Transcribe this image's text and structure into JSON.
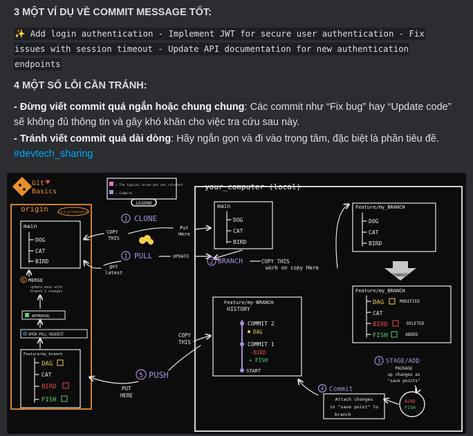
{
  "message": {
    "heading_3": "3 MỘT VÍ DỤ VỀ COMMIT MESSAGE TỐT:",
    "code_line_1": "✨ Add login authentication - Implement JWT for secure user authentication - Fix",
    "code_line_2": "issues with session timeout - Update API documentation for new authentication",
    "code_line_3": "endpoints",
    "heading_4": "4 MỘT SỐ LỖI CẦN TRÁNH:",
    "tip1_dash": "- ",
    "tip1_bold": "Đừng viết commit quá ngắn hoặc chung chung",
    "tip1_rest": ": Các commit như “Fix bug” hay “Update code” sẽ không đủ thông tin và gây khó khăn cho việc tra cứu sau này.",
    "tip2_dash": "- ",
    "tip2_bold": "Tránh viết commit quá dài dòng",
    "tip2_rest": ": Hãy ngắn gọn và đi vào trọng tâm, đặc biệt là phần tiêu đề.",
    "hashtag": "#devtech_sharing"
  },
  "diagram": {
    "logo_line1": "Git",
    "logo_line2": "Basics",
    "legend_item1": "= The typical arrow but not relevant",
    "legend_item2": "= Commits",
    "legend_title": "LEGEND",
    "origin_title": "origin",
    "origin_note": "a.k.a github/gitlab",
    "computer_title": "your_computer (local)",
    "main_label": "main",
    "files_dog": "DOG",
    "files_cat": "CAT",
    "files_bird": "BIRD",
    "files_fish": "FISH",
    "step_clone": "CLONE",
    "clone_copy": "COPY",
    "clone_this": "THIS",
    "put_here_1": "Put",
    "put_here_2": "Here",
    "step_pull": "PULL",
    "pull_update": "UPDATE",
    "pull_get": "get",
    "pull_latest": "latest",
    "step_branch": "BRANCH",
    "branch_copy": "COPY THIS",
    "branch_work": "work on copy Here",
    "feature_branch": "Feature/my_BRANCH",
    "changes": "CHANGES",
    "modified": "MODIFIED",
    "deleted": "DELETED",
    "added": "ADDED",
    "merge_title": "MERGE",
    "merge_desc_1": "update main with",
    "merge_desc_2": "branch's changes",
    "approval": "APPROVAL",
    "open_pr": "OPEN PULL REQUEST",
    "origin_feature": "Feature/my_branch",
    "history_title_1": "Feature/my-BRANCH",
    "history_title_2": "HISTORY",
    "commit_2": "COMMIT 2",
    "commit_2_dag": "DAG",
    "commit_1": "COMMIT 1",
    "commit_1_bird": "-BIRD",
    "commit_1_fish": "+ FISH",
    "history_start": "START",
    "copy_this_push_1": "COPY",
    "copy_this_push_2": "THIS",
    "step_push": "PUSH",
    "push_put_1": "PUT",
    "push_put_2": "HERE",
    "step_stage": "STAGE/ADD",
    "stage_desc_1": "PACKAGE",
    "stage_desc_2": "up changes as",
    "stage_desc_3": "\"save points\"",
    "step_commit": "Commit",
    "commit_desc_1": "Attach changes",
    "commit_desc_2": "in \"save point\" to",
    "commit_desc_3": "branch",
    "num_1": "1",
    "num_2": "2",
    "num_3": "3",
    "num_4": "4",
    "num_5": "5",
    "num_6": "6"
  },
  "colors": {
    "background": "#2b2d31",
    "code_bg": "#1e1f22",
    "link": "#00a8fc",
    "diagram_bg": "#0c0c0d",
    "orange": "#e8902c",
    "purple": "#a890d8",
    "yellow": "#f2d04a",
    "red": "#e84a4a",
    "green": "#5cd26a",
    "blue": "#6aa8e8"
  }
}
